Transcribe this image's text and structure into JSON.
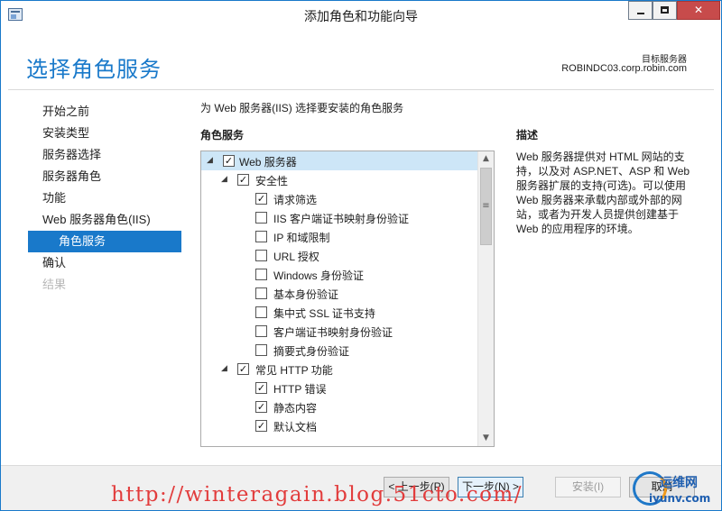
{
  "window": {
    "title": "添加角色和功能向导",
    "minimize_glyph": "",
    "maximize_glyph": "",
    "close_glyph": "✕"
  },
  "header": {
    "page_title": "选择角色服务",
    "target_label": "目标服务器",
    "target_server": "ROBINDC03.corp.robin.com"
  },
  "nav": {
    "items": [
      {
        "label": "开始之前"
      },
      {
        "label": "安装类型"
      },
      {
        "label": "服务器选择"
      },
      {
        "label": "服务器角色"
      },
      {
        "label": "功能"
      },
      {
        "label": "Web 服务器角色(IIS)"
      },
      {
        "label": "角色服务"
      },
      {
        "label": "确认"
      },
      {
        "label": "结果"
      }
    ]
  },
  "main": {
    "prompt": "为 Web 服务器(IIS) 选择要安装的角色服务",
    "list_header": "角色服务",
    "tree": [
      {
        "label": "Web 服务器",
        "checked": true,
        "expanded": true
      },
      {
        "label": "安全性",
        "checked": true,
        "expanded": true
      },
      {
        "label": "请求筛选",
        "checked": true
      },
      {
        "label": "IIS 客户端证书映射身份验证",
        "checked": false
      },
      {
        "label": "IP 和域限制",
        "checked": false
      },
      {
        "label": "URL 授权",
        "checked": false
      },
      {
        "label": "Windows 身份验证",
        "checked": false
      },
      {
        "label": "基本身份验证",
        "checked": false
      },
      {
        "label": "集中式 SSL 证书支持",
        "checked": false
      },
      {
        "label": "客户端证书映射身份验证",
        "checked": false
      },
      {
        "label": "摘要式身份验证",
        "checked": false
      },
      {
        "label": "常见 HTTP 功能",
        "checked": true,
        "expanded": true
      },
      {
        "label": "HTTP 错误",
        "checked": true
      },
      {
        "label": "静态内容",
        "checked": true
      },
      {
        "label": "默认文档",
        "checked": true
      }
    ],
    "scrollbar": {
      "up_glyph": "▲",
      "down_glyph": "▼",
      "thumb_glyph": "≡"
    }
  },
  "description": {
    "heading": "描述",
    "body": "Web 服务器提供对 HTML 网站的支持，以及对 ASP.NET、ASP 和 Web 服务器扩展的支持(可选)。可以使用 Web 服务器来承载内部或外部的网站，或者为开发人员提供创建基于 Web 的应用程序的环境。"
  },
  "footer": {
    "prev_label": "< 上一步(P)",
    "next_label": "下一步(N) >",
    "install_label": "安装(I)",
    "cancel_label": "取消"
  },
  "watermark": {
    "url": "http://winteragain.blog.51cto.com/",
    "logo_text1": "运维网",
    "logo_text2": "iyunv.com"
  }
}
